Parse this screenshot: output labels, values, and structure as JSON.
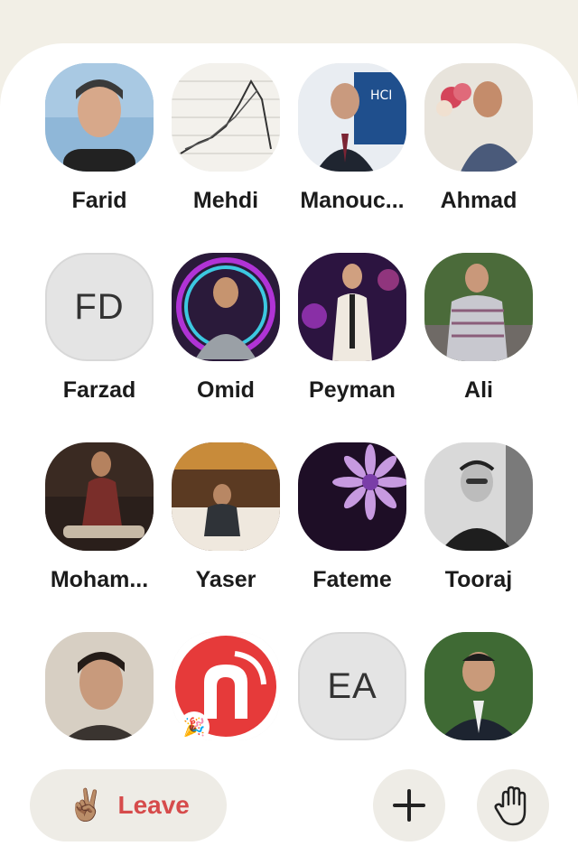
{
  "room": {
    "participants": [
      {
        "name": "Farid",
        "avatar_type": "photo",
        "avatar_desc": "man-portrait"
      },
      {
        "name": "Mehdi",
        "avatar_type": "photo",
        "avatar_desc": "chart-paper"
      },
      {
        "name": "Manouc...",
        "avatar_type": "photo",
        "avatar_desc": "man-at-conference"
      },
      {
        "name": "Ahmad",
        "avatar_type": "photo",
        "avatar_desc": "man-with-flowers"
      },
      {
        "name": "Farzad",
        "avatar_type": "initials",
        "initials": "FD"
      },
      {
        "name": "Omid",
        "avatar_type": "photo",
        "avatar_desc": "man-neon-frame"
      },
      {
        "name": "Peyman",
        "avatar_type": "photo",
        "avatar_desc": "man-night-purple"
      },
      {
        "name": "Ali",
        "avatar_type": "photo",
        "avatar_desc": "man-outdoor"
      },
      {
        "name": "Moham...",
        "avatar_type": "photo",
        "avatar_desc": "man-on-sofa"
      },
      {
        "name": "Yaser",
        "avatar_type": "photo",
        "avatar_desc": "man-in-cafe"
      },
      {
        "name": "Fateme",
        "avatar_type": "photo",
        "avatar_desc": "purple-flower"
      },
      {
        "name": "Tooraj",
        "avatar_type": "photo",
        "avatar_desc": "man-glasses-bw"
      },
      {
        "name": "",
        "avatar_type": "photo",
        "avatar_desc": "man-selfie"
      },
      {
        "name": "",
        "avatar_type": "photo",
        "avatar_desc": "red-logo",
        "badge": "🎉"
      },
      {
        "name": "",
        "avatar_type": "initials",
        "initials": "EA"
      },
      {
        "name": "",
        "avatar_type": "photo",
        "avatar_desc": "man-suit-garden"
      }
    ]
  },
  "controls": {
    "leave_label": "Leave",
    "leave_emoji": "✌🏽",
    "add_icon": "plus-icon",
    "raise_hand_icon": "raise-hand-icon"
  },
  "colors": {
    "page_bg": "#f2efe6",
    "sheet_bg": "#ffffff",
    "leave_text": "#d64b4b",
    "button_bg": "#eeece6"
  }
}
